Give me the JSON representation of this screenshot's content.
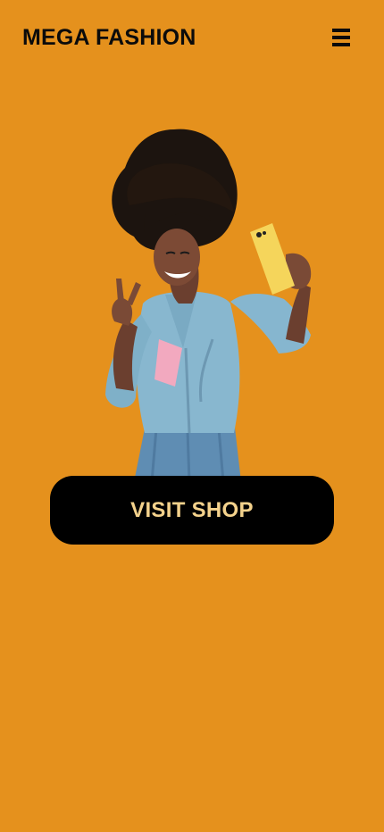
{
  "header": {
    "brand": "MEGA FASHION",
    "menu_icon": "hamburger-menu-icon"
  },
  "hero": {
    "image": "woman-taking-selfie-illustration"
  },
  "cta": {
    "label": "VISIT SHOP"
  },
  "colors": {
    "background": "#e5911d",
    "text": "#0b0b0b",
    "button_bg": "#000000",
    "button_text": "#f4d28c"
  }
}
